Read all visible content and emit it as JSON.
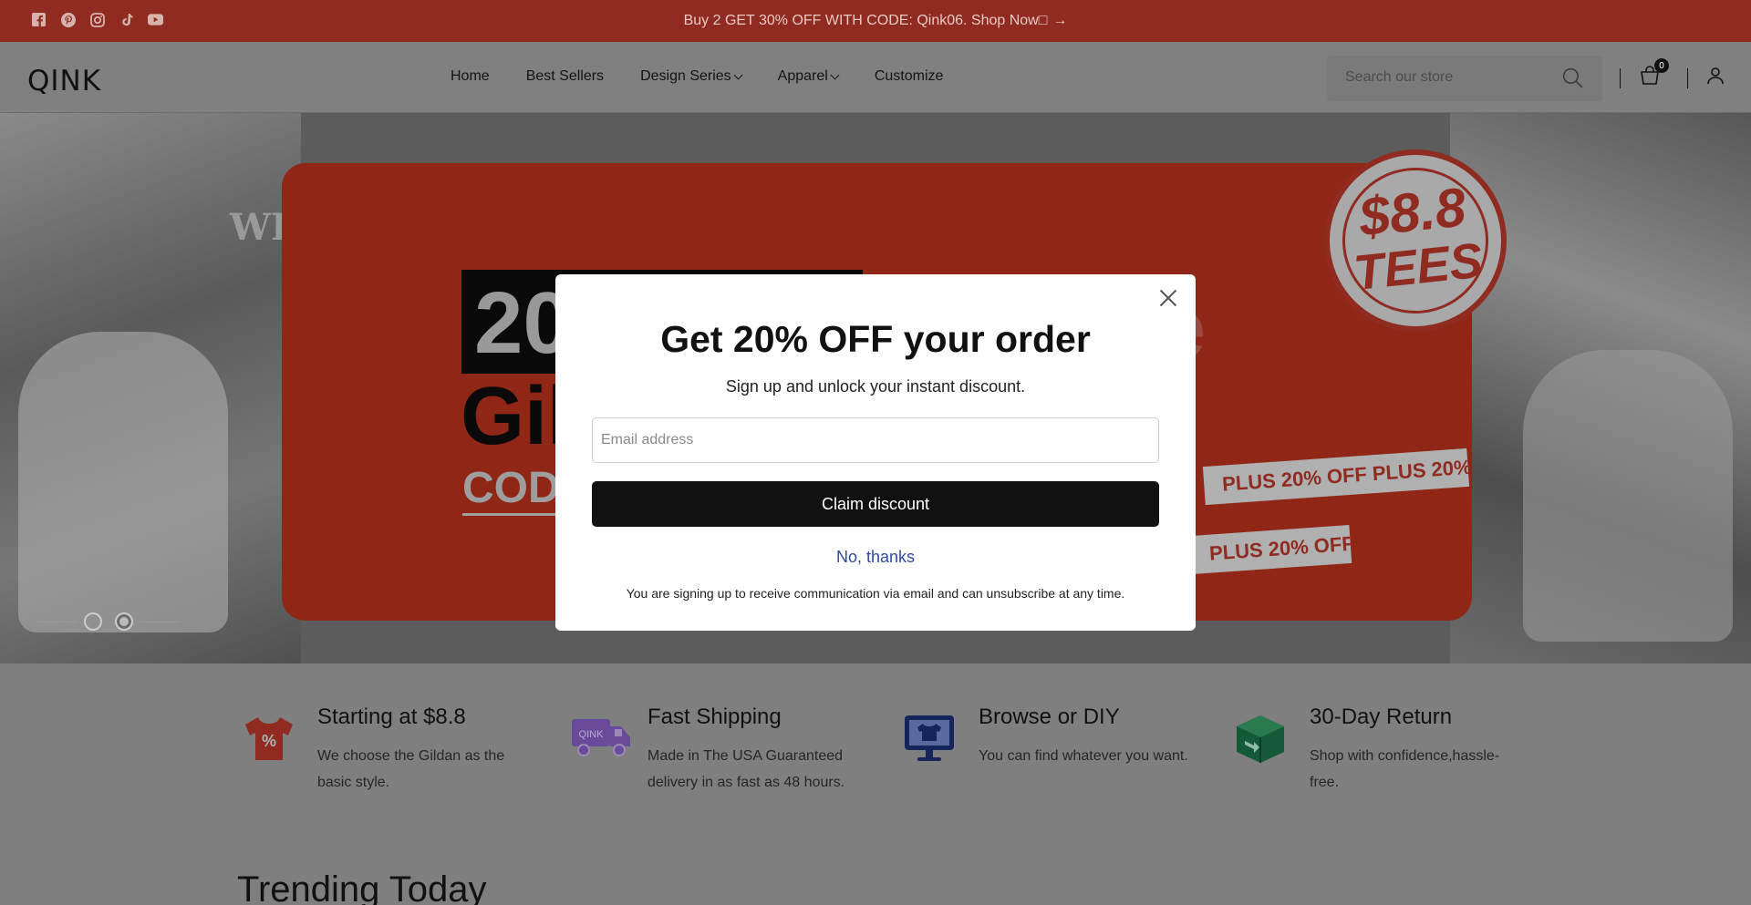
{
  "announcement": {
    "text": "Buy 2 GET 30% OFF WITH CODE: Qink06. Shop Now",
    "shop_glyph": "□",
    "arrow": "→",
    "socials": [
      "facebook-icon",
      "pinterest-icon",
      "instagram-icon",
      "tiktok-icon",
      "youtube-icon"
    ]
  },
  "header": {
    "logo": "QINK",
    "nav": {
      "home": "Home",
      "best_sellers": "Best Sellers",
      "design_series": "Design Series",
      "apparel": "Apparel",
      "customize": "Customize"
    },
    "search_placeholder": "Search our store",
    "cart_count": "0"
  },
  "hero": {
    "we_text": "WE",
    "big_number": "20",
    "brand_partial": "Gil",
    "code_partial": "COD",
    "right_partial": "e",
    "stamp_price": "$8.8",
    "stamp_label": "TEES",
    "ribbon_1": "PLUS 20% OFF    PLUS 20%",
    "ribbon_2": "PLUS 20% OFF",
    "slide_count": 2,
    "active_slide": 2
  },
  "features": [
    {
      "title": "Starting at $8.8",
      "desc": "We choose the Gildan as the basic style.",
      "icon": "discount-shirt-icon",
      "color": "#8f2b20"
    },
    {
      "title": "Fast Shipping",
      "desc": "Made in The USA Guaranteed delivery in as fast as 48 hours.",
      "icon": "delivery-truck-icon",
      "color": "#6a4a9a"
    },
    {
      "title": "Browse or DIY",
      "desc": "You can find whatever you want.",
      "icon": "monitor-shirt-icon",
      "color": "#16245c"
    },
    {
      "title": "30-Day Return",
      "desc": "Shop with confidence,hassle-free.",
      "icon": "return-box-icon",
      "color": "#145a36"
    }
  ],
  "trending_title": "Trending Today",
  "modal": {
    "title": "Get 20% OFF your order",
    "subtitle": "Sign up and unlock your instant discount.",
    "email_placeholder": "Email address",
    "claim_label": "Claim discount",
    "decline_label": "No, thanks",
    "disclaimer": "You are signing up to receive communication via email and can unsubscribe at any time."
  },
  "colors": {
    "announcement_bg": "#8f2b20",
    "overlay": "#7a7a7a",
    "link_blue": "#2f4aa0",
    "button_black": "#111111"
  }
}
